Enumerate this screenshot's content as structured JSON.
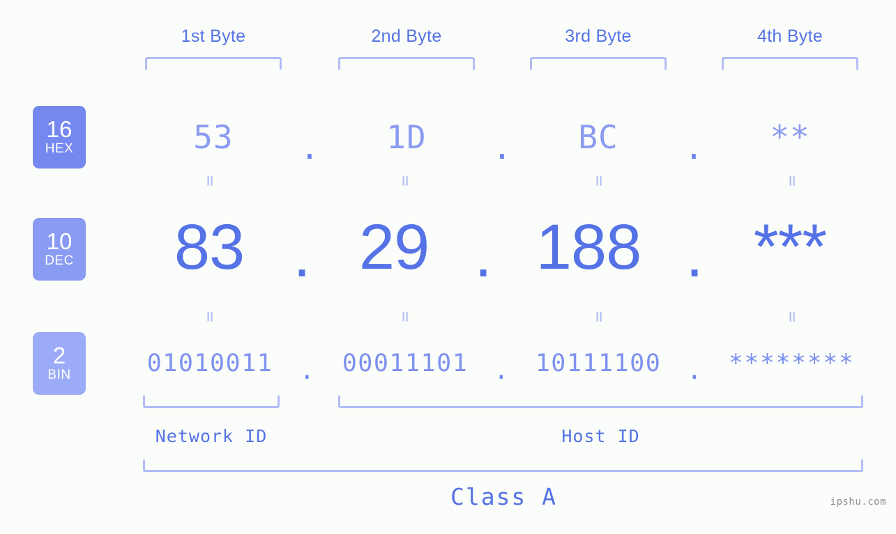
{
  "background": "#fbfdfa",
  "accent": "#5573e6",
  "bracket_color": "#b2bdf7",
  "watermark": "ipshu.com",
  "headers": {
    "byte1": "1st Byte",
    "byte2": "2nd Byte",
    "byte3": "3rd Byte",
    "byte4": "4th Byte"
  },
  "bases": [
    {
      "number": "16",
      "name": "HEX",
      "color": "#7588ef"
    },
    {
      "number": "10",
      "name": "DEC",
      "color": "#8a9bf3"
    },
    {
      "number": "2",
      "name": "BIN",
      "color": "#9cabf7"
    }
  ],
  "rows": {
    "hex": {
      "base_number": "16",
      "base_name": "HEX",
      "octets": [
        "53",
        "1D",
        "BC",
        "**"
      ],
      "separator": "."
    },
    "dec": {
      "base_number": "10",
      "base_name": "DEC",
      "octets": [
        "83",
        "29",
        "188",
        "***"
      ],
      "separator": "."
    },
    "bin": {
      "base_number": "2",
      "base_name": "BIN",
      "octets": [
        "01010011",
        "00011101",
        "10111100",
        "********"
      ],
      "separator": "."
    }
  },
  "equals_glyph": "=",
  "sections": {
    "network_id": "Network ID",
    "host_id": "Host ID",
    "class": "Class A"
  }
}
